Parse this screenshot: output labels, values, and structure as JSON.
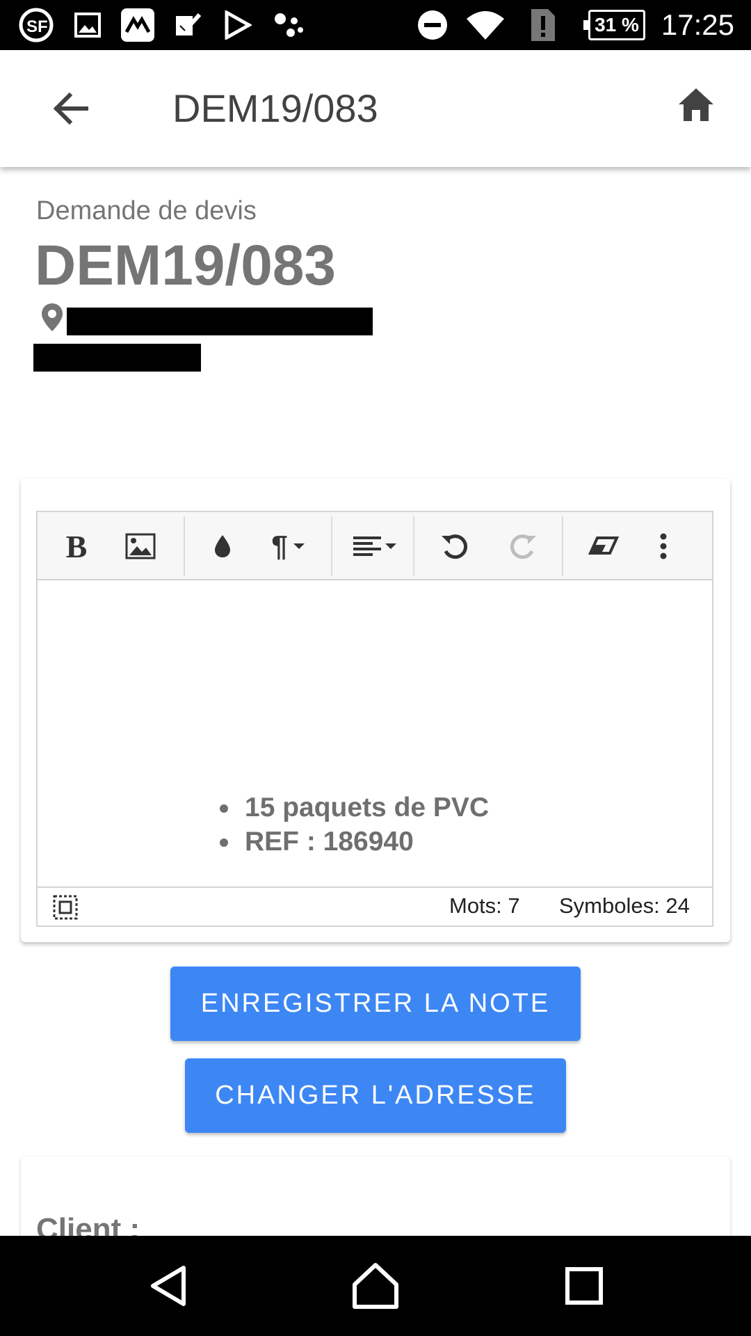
{
  "status_bar": {
    "time": "17:25",
    "battery": "31 %",
    "icons": [
      "sf-app-icon",
      "image-icon",
      "app-icon",
      "check-icon",
      "play-store-icon",
      "assistant-icon",
      "do-not-disturb-icon",
      "wifi-icon",
      "sim-alert-icon",
      "battery-icon"
    ]
  },
  "app_bar": {
    "title": "DEM19/083",
    "back_icon": "arrow-back-icon",
    "home_icon": "home-icon"
  },
  "header": {
    "doc_type": "Demande de devis",
    "doc_number": "DEM19/083",
    "location_icon": "pin-icon"
  },
  "editor": {
    "toolbar": [
      "bold",
      "image",
      "color",
      "paragraph",
      "align",
      "undo",
      "redo",
      "eraser",
      "more"
    ],
    "bold_label": "B",
    "paragraph_label": "¶",
    "content": [
      "15 paquets de PVC",
      "REF : 186940"
    ],
    "words": "Mots: 7",
    "symbols": "Symboles: 24"
  },
  "buttons": {
    "save_note": "ENREGISTRER LA NOTE",
    "change_address": "CHANGER L'ADRESSE"
  },
  "client": {
    "label": "Client :"
  },
  "colors": {
    "primary": "#3d87f5",
    "heading": "#757575"
  }
}
